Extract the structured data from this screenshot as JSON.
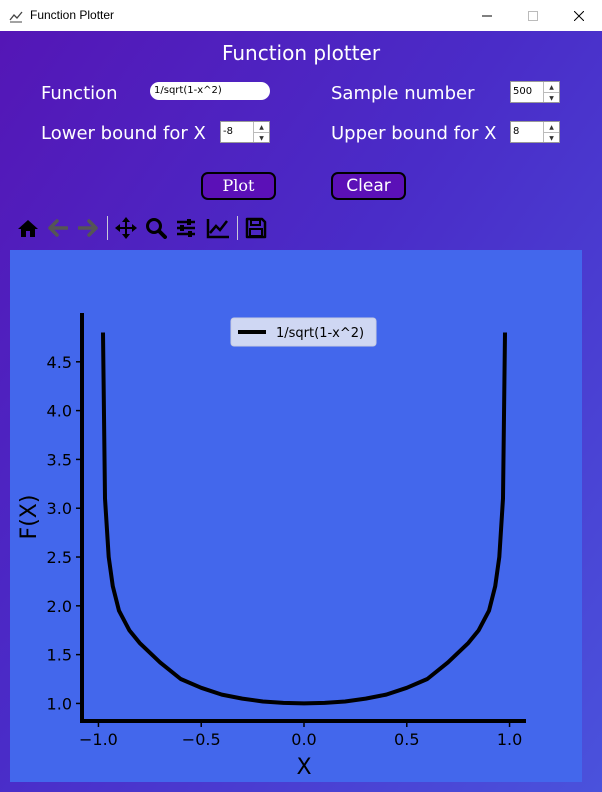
{
  "window": {
    "title": "Function Plotter",
    "app_icon": "chart-icon",
    "controls": [
      "minimize-icon",
      "maximize-icon",
      "close-icon"
    ]
  },
  "header": {
    "title": "Function plotter"
  },
  "form": {
    "function_label": "Function",
    "function_value": "1/sqrt(1-x^2)",
    "sample_label": "Sample number",
    "sample_value": "500",
    "lower_label": "Lower bound for X",
    "lower_value": "-8",
    "upper_label": "Upper bound for X",
    "upper_value": "8"
  },
  "buttons": {
    "plot": "Plot",
    "clear": "Clear"
  },
  "toolbar": {
    "icons": [
      "home-icon",
      "back-arrow-icon",
      "forward-arrow-icon",
      "pan-move-icon",
      "zoom-icon",
      "configure-subplots-icon",
      "edit-axis-icon",
      "save-icon"
    ]
  },
  "colors": {
    "background_start": "#5416b6",
    "background_end": "#4a52dc",
    "plot_background": "#4367ec",
    "line": "#000000",
    "button": "#5b10b7"
  },
  "chart_data": {
    "type": "line",
    "xlabel": "X",
    "ylabel": "F(X)",
    "xlim": [
      -1.08,
      1.08
    ],
    "ylim": [
      0.82,
      5.0
    ],
    "xticks": [
      -1.0,
      -0.5,
      0.0,
      0.5,
      1.0
    ],
    "xtick_labels": [
      "−1.0",
      "−0.5",
      "0.0",
      "0.5",
      "1.0"
    ],
    "yticks": [
      1.0,
      1.5,
      2.0,
      2.5,
      3.0,
      3.5,
      4.0,
      4.5
    ],
    "ytick_labels": [
      "1.0",
      "1.5",
      "2.0",
      "2.5",
      "3.0",
      "3.5",
      "4.0",
      "4.5"
    ],
    "legend_location": "top-center",
    "grid": false,
    "series": [
      {
        "name": "1/sqrt(1-x^2)",
        "color": "#000000",
        "x": [
          -0.978,
          -0.968,
          -0.95,
          -0.93,
          -0.9,
          -0.85,
          -0.8,
          -0.7,
          -0.6,
          -0.5,
          -0.4,
          -0.3,
          -0.2,
          -0.1,
          0.0,
          0.1,
          0.2,
          0.3,
          0.4,
          0.5,
          0.6,
          0.7,
          0.8,
          0.85,
          0.9,
          0.93,
          0.95,
          0.968,
          0.978
        ],
        "y": [
          4.8,
          3.1,
          2.5,
          2.2,
          1.95,
          1.75,
          1.62,
          1.42,
          1.25,
          1.16,
          1.09,
          1.05,
          1.02,
          1.005,
          1.0,
          1.005,
          1.02,
          1.05,
          1.09,
          1.16,
          1.25,
          1.42,
          1.62,
          1.75,
          1.95,
          2.2,
          2.5,
          3.1,
          4.8
        ]
      }
    ]
  }
}
